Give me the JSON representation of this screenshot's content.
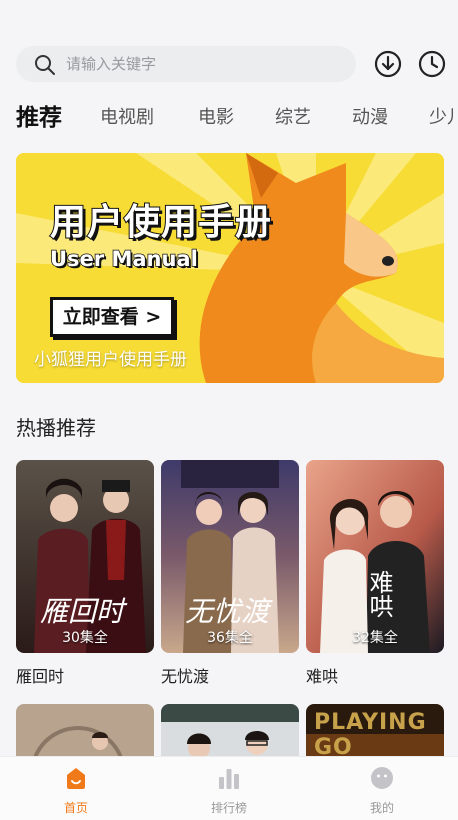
{
  "search": {
    "placeholder": "请输入关键字"
  },
  "header_icons": [
    "download-icon",
    "history-icon"
  ],
  "tabs": [
    "推荐",
    "电视剧",
    "电影",
    "综艺",
    "动漫",
    "少儿"
  ],
  "active_tab": "推荐",
  "banner": {
    "title": "用户使用手册",
    "subtitle": "User Manual",
    "button_label": "立即查看 >",
    "caption": "小狐狸用户使用手册"
  },
  "section": {
    "title": "热播推荐",
    "items": [
      {
        "name": "雁回时",
        "episodes": "30集全",
        "poster_text": "雁回时"
      },
      {
        "name": "无忧渡",
        "episodes": "36集全",
        "poster_text": "无忧渡"
      },
      {
        "name": "难哄",
        "episodes": "32集全",
        "poster_text": "难哄"
      }
    ],
    "next_row_poster_text": [
      "",
      "",
      "PLAYING GO"
    ]
  },
  "bottom_nav": [
    {
      "label": "首页",
      "icon": "home-icon",
      "active": true
    },
    {
      "label": "排行榜",
      "icon": "ranking-icon",
      "active": false
    },
    {
      "label": "我的",
      "icon": "profile-icon",
      "active": false
    }
  ],
  "colors": {
    "accent": "#f07a1a",
    "banner_bg": "#f7dc35",
    "page_bg": "#f5f5f7"
  }
}
